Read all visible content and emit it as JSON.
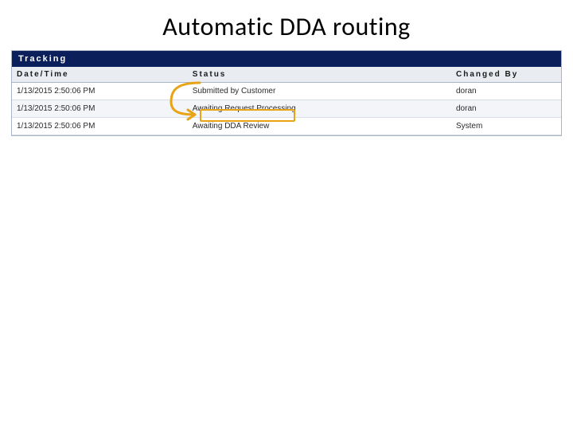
{
  "title": "Automatic DDA routing",
  "panel": {
    "heading": "Tracking"
  },
  "columns": {
    "date": "Date/Time",
    "status": "Status",
    "by": "Changed By"
  },
  "rows": [
    {
      "date": "1/13/2015 2:50:06 PM",
      "status": "Submitted by Customer",
      "by": "doran"
    },
    {
      "date": "1/13/2015 2:50:06 PM",
      "status": "Awaiting Request Processing",
      "by": "doran"
    },
    {
      "date": "1/13/2015 2:50:06 PM",
      "status": "Awaiting DDA Review",
      "by": "System"
    }
  ],
  "annotations": {
    "arrow_color": "#e8a317",
    "highlight_color": "#e8a317"
  }
}
